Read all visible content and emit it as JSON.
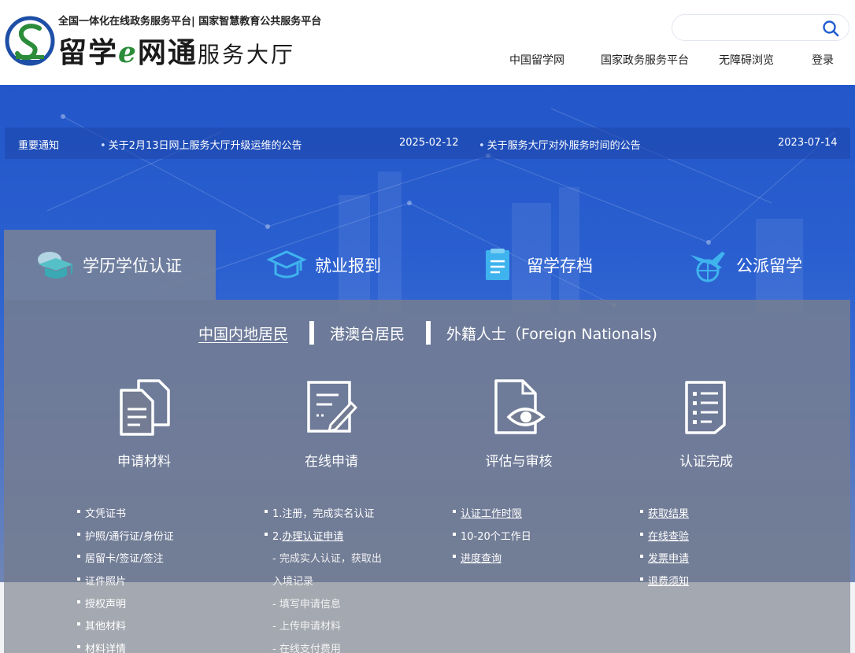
{
  "header": {
    "subtitle": "全国一体化在线政务服务平台| 国家智慧教育公共服务平台",
    "brand_a": "留学",
    "brand_e": "e",
    "brand_b": "网通",
    "brand_hall": "服务大厅",
    "search_placeholder": "",
    "nav": [
      "中国留学网",
      "国家政务服务平台",
      "无障碍浏览",
      "登录"
    ]
  },
  "notice": {
    "label": "重要通知",
    "items": [
      {
        "title": "关于2月13日网上服务大厅升级运维的公告",
        "date": "2025-02-12"
      },
      {
        "title": "关于服务大厅对外服务时间的公告",
        "date": "2023-07-14"
      }
    ]
  },
  "tabs": [
    "学历学位认证",
    "就业报到",
    "留学存档",
    "公派留学"
  ],
  "subtabs": [
    "中国内地居民",
    "港澳台居民",
    "外籍人士（Foreign Nationals)"
  ],
  "steps": [
    "申请材料",
    "在线申请",
    "评估与审核",
    "认证完成"
  ],
  "lists": {
    "materials": [
      "文凭证书",
      "护照/通行证/身份证",
      "居留卡/签证/签注",
      "证件照片",
      "授权声明",
      "其他材料",
      "材料详情"
    ],
    "online": [
      "1.注册，完成实名认证",
      "2.办理认证申请",
      "- 完成实人认证，获取出",
      "入境记录",
      "- 填写申请信息",
      "- 上传申请材料",
      "- 在线支付费用"
    ],
    "online_prefix": "2.",
    "online_link": "办理认证申请",
    "review": [
      "认证工作时限",
      "10-20个工作日",
      "进度查询"
    ],
    "done": [
      "获取结果",
      "在线查验",
      "发票申请",
      "退费须知"
    ]
  },
  "colors": {
    "hero": "#2357c9",
    "panel": "#737c92",
    "brand_green": "#2b8c3a",
    "search_icon": "#1f5bd0"
  }
}
